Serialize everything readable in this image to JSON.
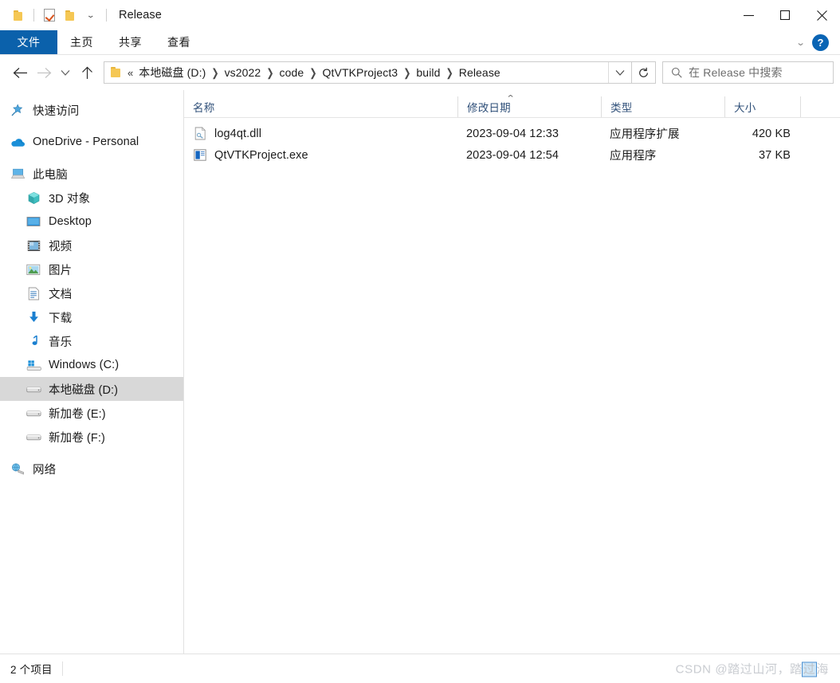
{
  "window": {
    "title": "Release",
    "quick_access": [
      {
        "name": "folder-icon",
        "label": ""
      },
      {
        "name": "properties-icon",
        "label": ""
      },
      {
        "name": "new-folder-icon",
        "label": ""
      },
      {
        "name": "customize-chevron-icon",
        "label": ""
      }
    ],
    "controls": {
      "minimize": "minimize-icon",
      "maximize": "maximize-icon",
      "close": "close-icon"
    }
  },
  "ribbon": {
    "tabs": [
      {
        "id": "file",
        "label": "文件",
        "active": true
      },
      {
        "id": "home",
        "label": "主页",
        "active": false
      },
      {
        "id": "share",
        "label": "共享",
        "active": false
      },
      {
        "id": "view",
        "label": "查看",
        "active": false
      }
    ],
    "collapse_label": "",
    "help_label": "?",
    "accent_color": "#0b61ab"
  },
  "nav": {
    "back_label": "←",
    "forward_label": "→",
    "recent_label": "⌄",
    "up_label": "↑",
    "breadcrumb_prefix": "«",
    "breadcrumbs": [
      "本地磁盘 (D:)",
      "vs2022",
      "code",
      "QtVTKProject3",
      "build",
      "Release"
    ],
    "refresh_label": "↻",
    "dropdown_label": "⌄"
  },
  "search": {
    "placeholder": "在 Release 中搜索",
    "icon": "search-icon"
  },
  "sidebar": {
    "items": [
      {
        "id": "quick-access",
        "label": "快速访问",
        "icon": "star-pin-icon",
        "indent": 0,
        "selected": false
      },
      {
        "id": "spacer1",
        "label": "",
        "icon": "",
        "indent": 0,
        "spacer": true
      },
      {
        "id": "onedrive",
        "label": "OneDrive - Personal",
        "icon": "onedrive-cloud-icon",
        "indent": 0,
        "selected": false
      },
      {
        "id": "spacer2",
        "label": "",
        "icon": "",
        "indent": 0,
        "spacer": true
      },
      {
        "id": "this-pc",
        "label": "此电脑",
        "icon": "this-pc-icon",
        "indent": 0,
        "selected": false
      },
      {
        "id": "3d-objects",
        "label": "3D 对象",
        "icon": "3d-objects-icon",
        "indent": 1,
        "selected": false
      },
      {
        "id": "desktop",
        "label": "Desktop",
        "icon": "desktop-icon",
        "indent": 1,
        "selected": false
      },
      {
        "id": "videos",
        "label": "视频",
        "icon": "videos-icon",
        "indent": 1,
        "selected": false
      },
      {
        "id": "pictures",
        "label": "图片",
        "icon": "pictures-icon",
        "indent": 1,
        "selected": false
      },
      {
        "id": "documents",
        "label": "文档",
        "icon": "documents-icon",
        "indent": 1,
        "selected": false
      },
      {
        "id": "downloads",
        "label": "下载",
        "icon": "downloads-icon",
        "indent": 1,
        "selected": false
      },
      {
        "id": "music",
        "label": "音乐",
        "icon": "music-icon",
        "indent": 1,
        "selected": false
      },
      {
        "id": "windows-c",
        "label": "Windows (C:)",
        "icon": "windows-drive-icon",
        "indent": 1,
        "selected": false
      },
      {
        "id": "local-disk-d",
        "label": "本地磁盘 (D:)",
        "icon": "drive-icon",
        "indent": 1,
        "selected": true
      },
      {
        "id": "volume-e",
        "label": "新加卷 (E:)",
        "icon": "drive-icon",
        "indent": 1,
        "selected": false
      },
      {
        "id": "volume-f",
        "label": "新加卷 (F:)",
        "icon": "drive-icon",
        "indent": 1,
        "selected": false
      },
      {
        "id": "spacer3",
        "label": "",
        "icon": "",
        "indent": 0,
        "spacer": true
      },
      {
        "id": "network",
        "label": "网络",
        "icon": "network-icon",
        "indent": 0,
        "selected": false
      }
    ],
    "selection_color": "#d8d8d8"
  },
  "file_list": {
    "columns": [
      {
        "id": "name",
        "label": "名称",
        "sorted": true,
        "sort_dir": "asc"
      },
      {
        "id": "date",
        "label": "修改日期",
        "sorted": false
      },
      {
        "id": "type",
        "label": "类型",
        "sorted": false
      },
      {
        "id": "size",
        "label": "大小",
        "sorted": false
      }
    ],
    "rows": [
      {
        "name": "log4qt.dll",
        "date": "2023-09-04 12:33",
        "type": "应用程序扩展",
        "size": "420 KB",
        "icon": "dll-file-icon"
      },
      {
        "name": "QtVTKProject.exe",
        "date": "2023-09-04 12:54",
        "type": "应用程序",
        "size": "37 KB",
        "icon": "exe-file-icon"
      }
    ]
  },
  "status": {
    "item_count": "2 个项目",
    "watermark_prefix": "CSDN @踏过山河，踏",
    "watermark_highlight": "过",
    "watermark_suffix": "海"
  }
}
